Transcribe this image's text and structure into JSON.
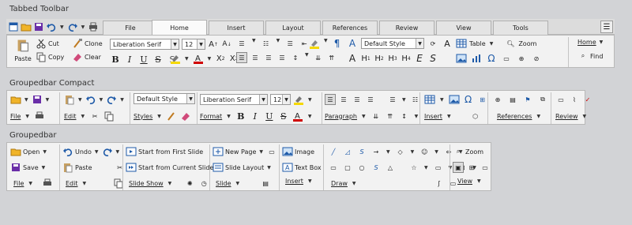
{
  "titles": {
    "tabbed": "Tabbed Toolbar",
    "compact": "Groupedbar Compact",
    "grouped": "Groupedbar"
  },
  "tabs": [
    "File",
    "Home",
    "Insert",
    "Layout",
    "References",
    "Review",
    "View",
    "Tools"
  ],
  "active_tab": "Home",
  "tabbed": {
    "clone": "Clone",
    "clear": "Clear",
    "cut": "Cut",
    "copy": "Copy",
    "paste": "Paste",
    "font": "Liberation Serif",
    "size": "12",
    "style": "Default Style",
    "table": "Table",
    "zoom": "Zoom",
    "home": "Home",
    "find": "Find"
  },
  "compact": {
    "file": "File",
    "edit": "Edit",
    "styles": "Styles",
    "style_combo": "Default Style",
    "font": "Liberation Serif",
    "size": "12",
    "format": "Format",
    "paragraph": "Paragraph",
    "insert": "Insert",
    "references": "References",
    "review": "Review"
  },
  "grouped": {
    "open": "Open",
    "save": "Save",
    "file": "File",
    "undo": "Undo",
    "paste": "Paste",
    "edit": "Edit",
    "start_first": "Start from First Slide",
    "start_current": "Start from Current Slide",
    "slide_show": "Slide Show",
    "new_page": "New Page",
    "slide_layout": "Slide Layout",
    "slide": "Slide",
    "image": "Image",
    "text_box": "Text Box",
    "insert": "Insert",
    "draw": "Draw",
    "zoom": "Zoom",
    "view": "View"
  },
  "colors": {
    "accent": "#1e5aa8",
    "highlight": "#f5d800",
    "font_red": "#d00000",
    "panel": "#f2f2f2",
    "bg": "#d2d3d6"
  }
}
